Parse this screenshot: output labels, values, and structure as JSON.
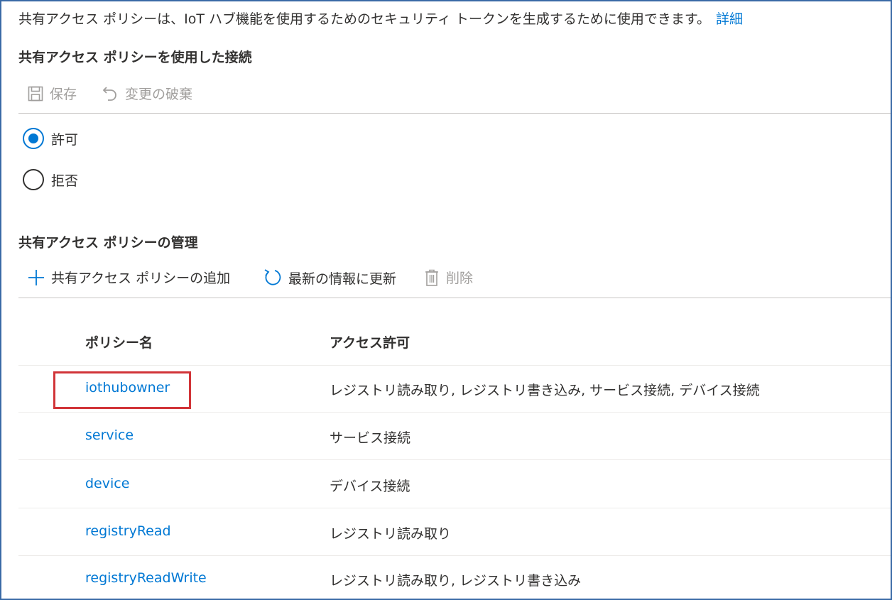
{
  "description": {
    "text": "共有アクセス ポリシーは、IoT ハブ機能を使用するためのセキュリティ トークンを生成するために使用できます。",
    "link": "詳細"
  },
  "connect_section": {
    "title": "共有アクセス ポリシーを使用した接続",
    "toolbar": {
      "save_label": "保存",
      "discard_label": "変更の破棄"
    },
    "options": [
      {
        "label": "許可",
        "selected": true
      },
      {
        "label": "拒否",
        "selected": false
      }
    ]
  },
  "manage_section": {
    "title": "共有アクセス ポリシーの管理",
    "toolbar": {
      "add_label": "共有アクセス ポリシーの追加",
      "refresh_label": "最新の情報に更新",
      "delete_label": "削除"
    },
    "table": {
      "columns": [
        "ポリシー名",
        "アクセス許可"
      ],
      "rows": [
        {
          "name": "iothubowner",
          "permissions": "レジストリ読み取り, レジストリ書き込み, サービス接続, デバイス接続"
        },
        {
          "name": "service",
          "permissions": "サービス接続"
        },
        {
          "name": "device",
          "permissions": "デバイス接続"
        },
        {
          "name": "registryRead",
          "permissions": "レジストリ読み取り"
        },
        {
          "name": "registryReadWrite",
          "permissions": "レジストリ読み取り, レジストリ書き込み"
        }
      ]
    }
  },
  "colors": {
    "accent": "#0078d4",
    "highlight": "#d13438",
    "disabled": "#a19f9d"
  }
}
